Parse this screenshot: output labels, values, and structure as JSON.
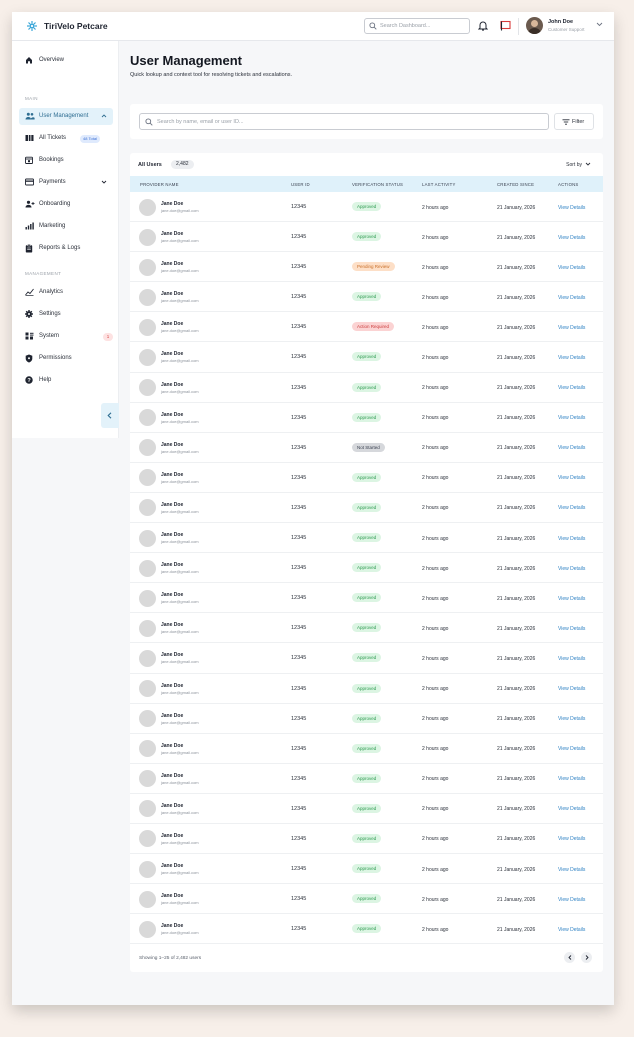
{
  "app": {
    "brand": "TiriVelo Petcare"
  },
  "topbar": {
    "search_placeholder": "Search Dashboard...",
    "user_name": "John Doe",
    "user_role": "Customer Support"
  },
  "sidebar": {
    "overview": "Overview",
    "section_main": "MAIN",
    "section_management": "MANAGEMENT",
    "items_main": [
      {
        "label": "User Management",
        "icon": "users-icon",
        "active": true
      },
      {
        "label": "All Tickets",
        "icon": "ticket-icon",
        "badge": "48 Total"
      },
      {
        "label": "Bookings",
        "icon": "calendar-icon"
      },
      {
        "label": "Payments",
        "icon": "card-icon"
      },
      {
        "label": "Onboarding",
        "icon": "user-plus-icon"
      },
      {
        "label": "Marketing",
        "icon": "bar-chart-icon"
      },
      {
        "label": "Reports & Logs",
        "icon": "clipboard-icon"
      }
    ],
    "items_mgmt": [
      {
        "label": "Analytics",
        "icon": "analytics-icon"
      },
      {
        "label": "Settings",
        "icon": "gear-icon"
      },
      {
        "label": "System",
        "icon": "system-icon",
        "badge": "1"
      },
      {
        "label": "Permissions",
        "icon": "shield-icon"
      },
      {
        "label": "Help",
        "icon": "help-icon"
      }
    ]
  },
  "page": {
    "title": "User Management",
    "subtitle": "Quick lookup and context tool for resolving tickets and escalations.",
    "search_placeholder": "Search by name, email or user ID...",
    "filter_label": "Filter"
  },
  "table": {
    "tab_label": "All Users",
    "count": "2,482",
    "sort_label": "Sort by",
    "columns": [
      "PROVIDER NAME",
      "USER ID",
      "VERIFICATION STATUS",
      "LAST ACTIVITY",
      "CREATED SINCE",
      "ACTIONS"
    ],
    "status_colors": {
      "Approved": {
        "bg": "#dcf5e3",
        "fg": "#2c9a4f"
      },
      "Pending Review": {
        "bg": "#fddfc7",
        "fg": "#c9702b"
      },
      "Action Required": {
        "bg": "#fbd3d3",
        "fg": "#cc3d3d"
      },
      "Not Started": {
        "bg": "#d6d8dc",
        "fg": "#3a4150"
      }
    },
    "rows": [
      {
        "name": "Jane Doe",
        "email": "jane.doe@gmail.com",
        "id": "12345",
        "status": "Approved",
        "last": "2 hours ago",
        "created": "21 January, 2026",
        "action": "View Details"
      },
      {
        "name": "Jane Doe",
        "email": "jane.doe@gmail.com",
        "id": "12345",
        "status": "Approved",
        "last": "2 hours ago",
        "created": "21 January, 2026",
        "action": "View Details"
      },
      {
        "name": "Jane Doe",
        "email": "jane.doe@gmail.com",
        "id": "12345",
        "status": "Pending Review",
        "last": "2 hours ago",
        "created": "21 January, 2026",
        "action": "View Details"
      },
      {
        "name": "Jane Doe",
        "email": "jane.doe@gmail.com",
        "id": "12345",
        "status": "Approved",
        "last": "2 hours ago",
        "created": "21 January, 2026",
        "action": "View Details"
      },
      {
        "name": "Jane Doe",
        "email": "jane.doe@gmail.com",
        "id": "12345",
        "status": "Action Required",
        "last": "2 hours ago",
        "created": "21 January, 2026",
        "action": "View Details"
      },
      {
        "name": "Jane Doe",
        "email": "jane.doe@gmail.com",
        "id": "12345",
        "status": "Approved",
        "last": "2 hours ago",
        "created": "21 January, 2026",
        "action": "View Details"
      },
      {
        "name": "Jane Doe",
        "email": "jane.doe@gmail.com",
        "id": "12345",
        "status": "Approved",
        "last": "2 hours ago",
        "created": "21 January, 2026",
        "action": "View Details"
      },
      {
        "name": "Jane Doe",
        "email": "jane.doe@gmail.com",
        "id": "12345",
        "status": "Approved",
        "last": "2 hours ago",
        "created": "21 January, 2026",
        "action": "View Details"
      },
      {
        "name": "Jane Doe",
        "email": "jane.doe@gmail.com",
        "id": "12345",
        "status": "Not Started",
        "last": "2 hours ago",
        "created": "21 January, 2026",
        "action": "View Details"
      },
      {
        "name": "Jane Doe",
        "email": "jane.doe@gmail.com",
        "id": "12345",
        "status": "Approved",
        "last": "2 hours ago",
        "created": "21 January, 2026",
        "action": "View Details"
      },
      {
        "name": "Jane Doe",
        "email": "jane.doe@gmail.com",
        "id": "12345",
        "status": "Approved",
        "last": "2 hours ago",
        "created": "21 January, 2026",
        "action": "View Details"
      },
      {
        "name": "Jane Doe",
        "email": "jane.doe@gmail.com",
        "id": "12345",
        "status": "Approved",
        "last": "2 hours ago",
        "created": "21 January, 2026",
        "action": "View Details"
      },
      {
        "name": "Jane Doe",
        "email": "jane.doe@gmail.com",
        "id": "12345",
        "status": "Approved",
        "last": "2 hours ago",
        "created": "21 January, 2026",
        "action": "View Details"
      },
      {
        "name": "Jane Doe",
        "email": "jane.doe@gmail.com",
        "id": "12345",
        "status": "Approved",
        "last": "2 hours ago",
        "created": "21 January, 2026",
        "action": "View Details"
      },
      {
        "name": "Jane Doe",
        "email": "jane.doe@gmail.com",
        "id": "12345",
        "status": "Approved",
        "last": "2 hours ago",
        "created": "21 January, 2026",
        "action": "View Details"
      },
      {
        "name": "Jane Doe",
        "email": "jane.doe@gmail.com",
        "id": "12345",
        "status": "Approved",
        "last": "2 hours ago",
        "created": "21 January, 2026",
        "action": "View Details"
      },
      {
        "name": "Jane Doe",
        "email": "jane.doe@gmail.com",
        "id": "12345",
        "status": "Approved",
        "last": "2 hours ago",
        "created": "21 January, 2026",
        "action": "View Details"
      },
      {
        "name": "Jane Doe",
        "email": "jane.doe@gmail.com",
        "id": "12345",
        "status": "Approved",
        "last": "2 hours ago",
        "created": "21 January, 2026",
        "action": "View Details"
      },
      {
        "name": "Jane Doe",
        "email": "jane.doe@gmail.com",
        "id": "12345",
        "status": "Approved",
        "last": "2 hours ago",
        "created": "21 January, 2026",
        "action": "View Details"
      },
      {
        "name": "Jane Doe",
        "email": "jane.doe@gmail.com",
        "id": "12345",
        "status": "Approved",
        "last": "2 hours ago",
        "created": "21 January, 2026",
        "action": "View Details"
      },
      {
        "name": "Jane Doe",
        "email": "jane.doe@gmail.com",
        "id": "12345",
        "status": "Approved",
        "last": "2 hours ago",
        "created": "21 January, 2026",
        "action": "View Details"
      },
      {
        "name": "Jane Doe",
        "email": "jane.doe@gmail.com",
        "id": "12345",
        "status": "Approved",
        "last": "2 hours ago",
        "created": "21 January, 2026",
        "action": "View Details"
      },
      {
        "name": "Jane Doe",
        "email": "jane.doe@gmail.com",
        "id": "12345",
        "status": "Approved",
        "last": "2 hours ago",
        "created": "21 January, 2026",
        "action": "View Details"
      },
      {
        "name": "Jane Doe",
        "email": "jane.doe@gmail.com",
        "id": "12345",
        "status": "Approved",
        "last": "2 hours ago",
        "created": "21 January, 2026",
        "action": "View Details"
      },
      {
        "name": "Jane Doe",
        "email": "jane.doe@gmail.com",
        "id": "12345",
        "status": "Approved",
        "last": "2 hours ago",
        "created": "21 January, 2026",
        "action": "View Details"
      }
    ],
    "footer": "Showing 1–25 of 2,482 users"
  },
  "colors": {
    "accent": "#2f82c4",
    "active_bg": "#e3f2fa",
    "header_bg": "#dff1fa"
  }
}
